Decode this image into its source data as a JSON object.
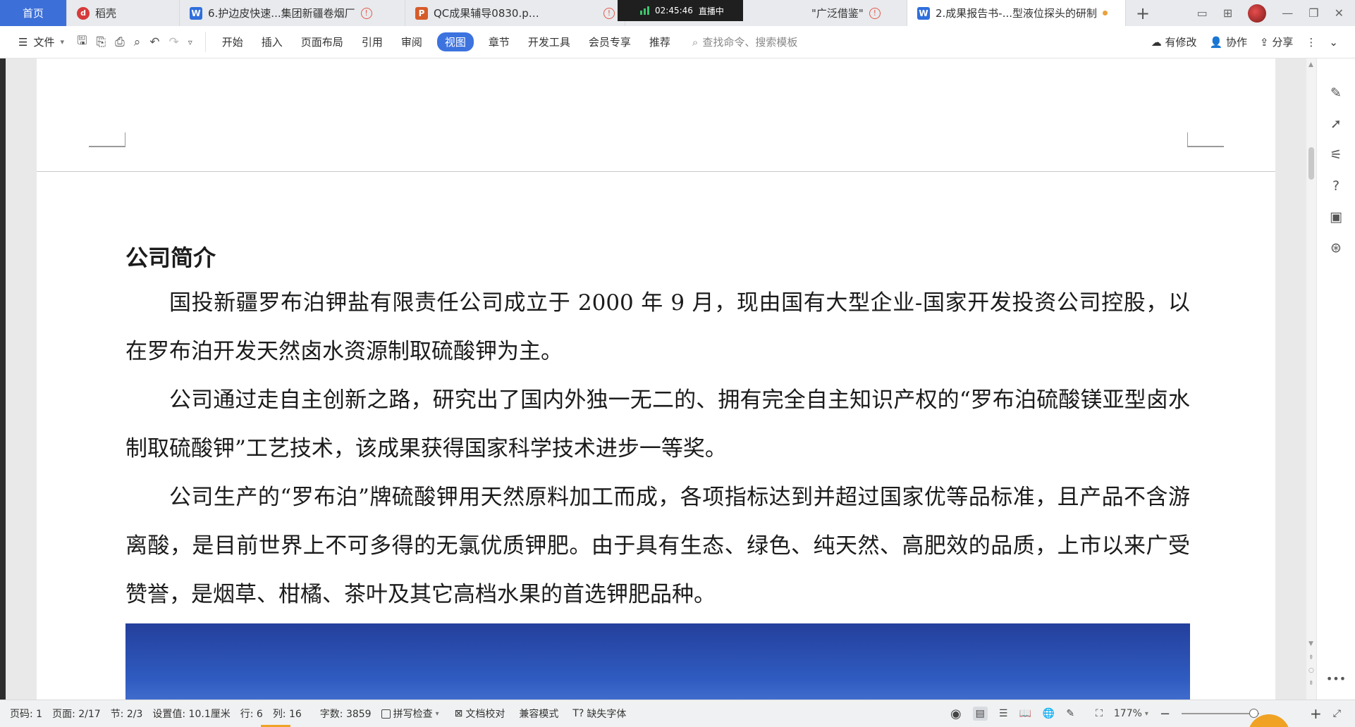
{
  "tabs": {
    "home": "首页",
    "daoke": "稻壳",
    "doc1": "6.护边皮快速...集团新疆卷烟厂",
    "qc": "QC成果辅导0830.pptx",
    "live_time": "02:45:46",
    "live_label": "直播中",
    "guang": "\"广泛借鉴\"",
    "active": "2.成果报告书-...型液位探头的研制",
    "new_tab": "+"
  },
  "ribbon": {
    "file": "文件",
    "start": "开始",
    "insert": "插入",
    "page_layout": "页面布局",
    "reference": "引用",
    "review": "审阅",
    "view": "视图",
    "chapter": "章节",
    "devtools": "开发工具",
    "member": "会员专享",
    "recommend": "推荐",
    "search_placeholder": "查找命令、搜索模板",
    "modified": "有修改",
    "collab": "协作",
    "share": "分享"
  },
  "document": {
    "heading": "公司简介",
    "paragraphs": [
      "国投新疆罗布泊钾盐有限责任公司成立于 2000 年 9 月，现由国有大型企业-国家开发投资公司控股，以在罗布泊开发天然卤水资源制取硫酸钾为主。",
      "公司通过走自主创新之路，研究出了国内外独一无二的、拥有完全自主知识产权的“罗布泊硫酸镁亚型卤水制取硫酸钾”工艺技术，该成果获得国家科学技术进步一等奖。",
      "公司生产的“罗布泊”牌硫酸钾用天然原料加工而成，各项指标达到并超过国家优等品标准，且产品不含游离酸，是目前世界上不可多得的无氯优质钾肥。由于具有生态、绿色、纯天然、高肥效的品质，上市以来广受赞誉，是烟草、柑橘、茶叶及其它高档水果的首选钾肥品种。"
    ]
  },
  "status": {
    "page_code": "页码: 1",
    "page": "页面: 2/17",
    "section": "节: 2/3",
    "setting": "设置值: 10.1厘米",
    "row": "行: 6",
    "col": "列: 16",
    "wordcount": "字数: 3859",
    "spellcheck": "拼写检查",
    "proofread": "文档校对",
    "compat": "兼容模式",
    "missing_font": "缺失字体",
    "zoom": "177%",
    "zoom_minus": "−",
    "zoom_plus": "+"
  },
  "colors": {
    "accent": "#3d73df",
    "home_tab": "#3c6fd8",
    "orange": "#f0a224"
  }
}
